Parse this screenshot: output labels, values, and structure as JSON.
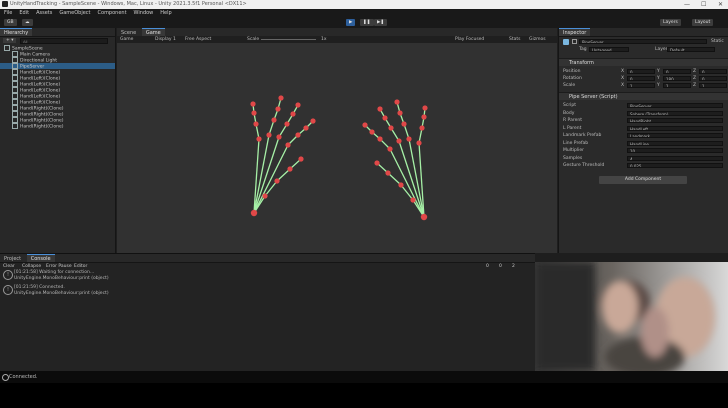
{
  "window": {
    "title": "UnityHandTracking - SampleScene - Windows, Mac, Linux - Unity 2021.3.5f1 Personal <DX11>",
    "controls": [
      "—",
      "☐",
      "✕"
    ]
  },
  "menu": [
    "File",
    "Edit",
    "Assets",
    "GameObject",
    "Component",
    "Window",
    "Help"
  ],
  "toolbar": {
    "account": "GB",
    "cloud": "☁",
    "layers": "Layers",
    "layout": "Layout",
    "play": "▶",
    "pause": "❚❚",
    "step": "▶❚"
  },
  "hierarchy": {
    "tab": "Hierarchy",
    "search_placeholder": "All",
    "items": [
      {
        "label": "SampleScene",
        "indent": 0,
        "selected": false
      },
      {
        "label": "Main Camera",
        "indent": 1,
        "selected": false
      },
      {
        "label": "Directional Light",
        "indent": 1,
        "selected": false
      },
      {
        "label": "PipeServer",
        "indent": 1,
        "selected": true
      },
      {
        "label": "Hand(Left)(Clone)",
        "indent": 1,
        "selected": false
      },
      {
        "label": "Hand(Left)(Clone)",
        "indent": 1,
        "selected": false
      },
      {
        "label": "Hand(Left)(Clone)",
        "indent": 1,
        "selected": false
      },
      {
        "label": "Hand(Left)(Clone)",
        "indent": 1,
        "selected": false
      },
      {
        "label": "Hand(Left)(Clone)",
        "indent": 1,
        "selected": false
      },
      {
        "label": "Hand(Left)(Clone)",
        "indent": 1,
        "selected": false
      },
      {
        "label": "Hand(Right)(Clone)",
        "indent": 1,
        "selected": false
      },
      {
        "label": "Hand(Right)(Clone)",
        "indent": 1,
        "selected": false
      },
      {
        "label": "Hand(Right)(Clone)",
        "indent": 1,
        "selected": false
      },
      {
        "label": "Hand(Right)(Clone)",
        "indent": 1,
        "selected": false
      }
    ]
  },
  "scene": {
    "tabs": [
      "Scene",
      "Game"
    ],
    "active_tab": "Game",
    "display": "Game",
    "display_num": "Display 1",
    "aspect": "Free Aspect",
    "scale_label": "Scale",
    "scale_value": "1x",
    "play_focused": "Play Focused",
    "stats": "Stats",
    "gizmos": "Gizmos"
  },
  "hands": {
    "joint_color": "#e04848",
    "bone_color": "#a6f0a6"
  },
  "inspector": {
    "tab": "Inspector",
    "object_name": "PipeServer",
    "static_label": "Static",
    "tag_label": "Tag",
    "tag_value": "Untagged",
    "layer_label": "Layer",
    "layer_value": "Default",
    "transform": {
      "header": "Transform",
      "position_label": "Position",
      "rotation_label": "Rotation",
      "scale_label": "Scale",
      "position": [
        "0",
        "0",
        "0"
      ],
      "rotation": [
        "0",
        "180",
        "0"
      ],
      "scale": [
        "1",
        "1",
        "1"
      ]
    },
    "script": {
      "header": "Pipe Server (Script)",
      "fields": [
        {
          "label": "Script",
          "value": "PipeServer"
        },
        {
          "label": "Body",
          "value": "Sphere (Transform)"
        },
        {
          "label": "R Parent",
          "value": "HandRight"
        },
        {
          "label": "L Parent",
          "value": "HandLeft"
        },
        {
          "label": "Landmark Prefab",
          "value": "Landmark"
        },
        {
          "label": "Line Prefab",
          "value": "HandLine"
        },
        {
          "label": "Multiplier",
          "value": "10"
        },
        {
          "label": "Samples",
          "value": "4"
        },
        {
          "label": "Gesture Threshold",
          "value": "0.025"
        }
      ]
    },
    "add_component": "Add Component"
  },
  "console": {
    "tabs": [
      "Project",
      "Console"
    ],
    "active_tab": "Console",
    "toolbar": [
      "Clear",
      "Collapse",
      "Error Pause",
      "Editor"
    ],
    "counts": [
      "0",
      "0",
      "2"
    ],
    "logs": [
      {
        "line1": "[01:21:58] Waiting for connection...",
        "line2": "UnityEngine.MonoBehaviour:print (object)"
      },
      {
        "line1": "[01:21:59] Connected.",
        "line2": "UnityEngine.MonoBehaviour:print (object)"
      }
    ]
  },
  "statusbar": {
    "text": "Connected."
  }
}
